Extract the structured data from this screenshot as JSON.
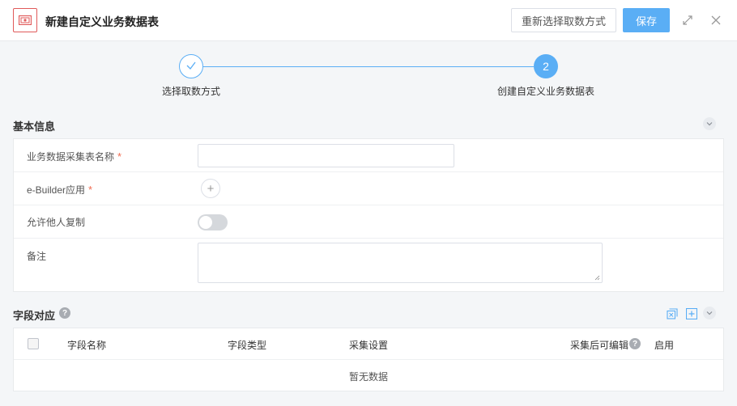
{
  "header": {
    "title": "新建自定义业务数据表",
    "reselect_label": "重新选择取数方式",
    "save_label": "保存"
  },
  "steps": [
    {
      "label": "选择取数方式",
      "state": "done"
    },
    {
      "label": "创建自定义业务数据表",
      "number": "2",
      "state": "active"
    }
  ],
  "basic_info": {
    "title": "基本信息",
    "fields": [
      {
        "label": "业务数据采集表名称",
        "required": "*",
        "type": "text",
        "value": ""
      },
      {
        "label": "e-Builder应用",
        "required": "*",
        "type": "add",
        "add_symbol": "+"
      },
      {
        "label": "允许他人复制",
        "type": "toggle",
        "value": "off"
      },
      {
        "label": "备注",
        "type": "textarea",
        "value": ""
      }
    ]
  },
  "field_mapping": {
    "title": "字段对应",
    "help": "?",
    "columns": [
      "字段名称",
      "字段类型",
      "采集设置",
      "采集后可编辑",
      "启用"
    ],
    "empty_text": "暂无数据"
  },
  "colors": {
    "accent": "#5aaef5",
    "required": "#f06a4f",
    "icon_red": "#e05a5a"
  },
  "icons": {
    "app": "image-frame-icon",
    "expand": "expand-icon",
    "close": "close-icon",
    "check": "check-icon",
    "copy": "copy-icon",
    "add": "add-square-icon",
    "collapse": "chevron-down-icon"
  }
}
